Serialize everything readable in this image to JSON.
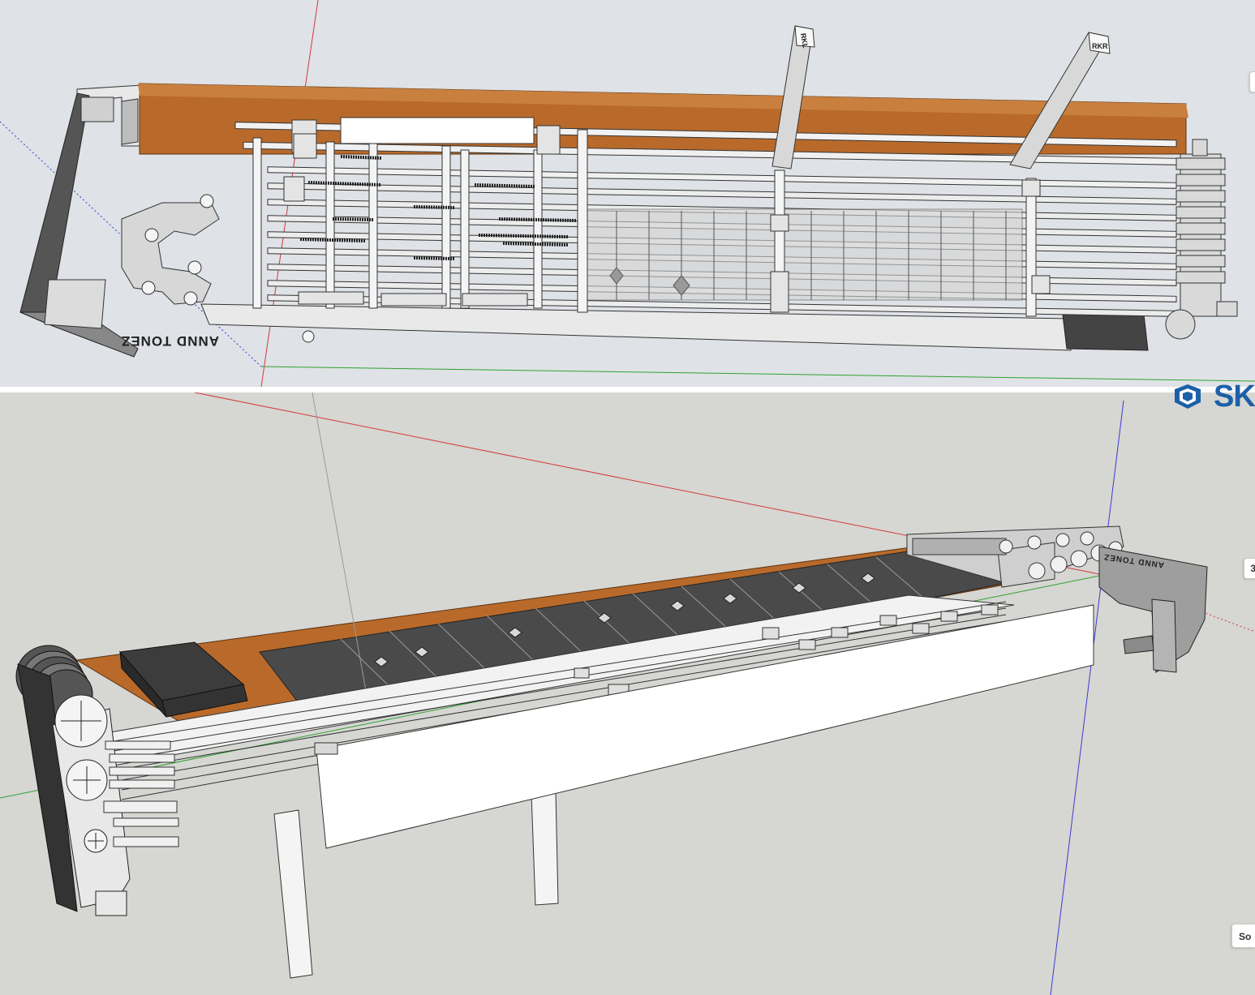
{
  "app": {
    "brand_fragment": "SK",
    "brand_color": "#1d5fa8"
  },
  "top_view": {
    "labels": {
      "rkl": "RKL",
      "rkr": "RKR",
      "body_signature": "ANND TONEZ"
    }
  },
  "bottom_view": {
    "labels": {
      "body_signature": "ANND TONEZ"
    }
  },
  "edge_tabs": {
    "top_tab": "",
    "mid_tab": "3",
    "bottom_tab": "So"
  },
  "colors": {
    "axis_red": "#d23a3a",
    "axis_green": "#2fa22f",
    "axis_blue": "#3a3ad2",
    "wood": "#b96a2a",
    "top_sky": "#dfe2e6",
    "bottom_sky": "#d6d6d3"
  }
}
